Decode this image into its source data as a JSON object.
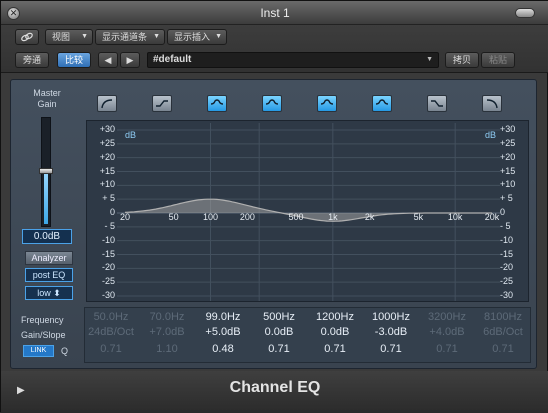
{
  "window": {
    "title": "Inst 1",
    "close_glyph": "✕"
  },
  "toolbar": {
    "link_icon": "link-icon",
    "view_label": "视图",
    "show_channel_strip_label": "显示通道条",
    "show_insert_label": "显示插入",
    "bypass_label": "旁通",
    "compare_label": "比较",
    "prev_label": "◀",
    "next_label": "▶",
    "preset_value": "#default",
    "copy_label": "拷贝",
    "paste_label": "粘贴",
    "dropdown_glyph": "▼"
  },
  "plugin": {
    "name": "Channel EQ",
    "master_gain_label": "Master\nGain",
    "master_gain_value": "0.0dB",
    "master_gain_level": 0.5,
    "analyzer_label": "Analyzer",
    "post_eq_label": "post EQ",
    "resolution_label": "low",
    "resolution_glyph": "⬍",
    "band_buttons": [
      {
        "icon": "low-cut-icon",
        "on": false
      },
      {
        "icon": "low-shelf-icon",
        "on": false
      },
      {
        "icon": "bell-band-icon",
        "on": true
      },
      {
        "icon": "bell-band-icon",
        "on": true
      },
      {
        "icon": "bell-band-icon",
        "on": true
      },
      {
        "icon": "bell-band-icon",
        "on": true
      },
      {
        "icon": "high-shelf-icon",
        "on": false
      },
      {
        "icon": "high-cut-icon",
        "on": false
      }
    ],
    "graph": {
      "db_unit": "dB",
      "db_ticks": [
        "+30",
        "+25",
        "+20",
        "+15",
        "+10",
        "+ 5",
        "0",
        "- 5",
        "-10",
        "-15",
        "-20",
        "-25",
        "-30"
      ],
      "freq_ticks": [
        "20",
        "50",
        "100",
        "200",
        "500",
        "1k",
        "2k",
        "5k",
        "10k",
        "20k"
      ],
      "curve_color": "#b0b0b0",
      "grid_color": "#43505e"
    },
    "params": {
      "frequency_label": "Frequency",
      "gain_slope_label": "Gain/Slope",
      "q_label": "Q",
      "link_label": "LINK",
      "bands": [
        {
          "freq": "50.0Hz",
          "gain": "24dB/Oct",
          "q": "0.71",
          "on": false
        },
        {
          "freq": "70.0Hz",
          "gain": "+7.0dB",
          "q": "1.10",
          "on": false
        },
        {
          "freq": "99.0Hz",
          "gain": "+5.0dB",
          "q": "0.48",
          "on": true
        },
        {
          "freq": "500Hz",
          "gain": "0.0dB",
          "q": "0.71",
          "on": true
        },
        {
          "freq": "1200Hz",
          "gain": "0.0dB",
          "q": "0.71",
          "on": true
        },
        {
          "freq": "1000Hz",
          "gain": "-3.0dB",
          "q": "0.71",
          "on": true
        },
        {
          "freq": "3200Hz",
          "gain": "+4.0dB",
          "q": "0.71",
          "on": false
        },
        {
          "freq": "8100Hz",
          "gain": "6dB/Oct",
          "q": "0.71",
          "on": false
        }
      ]
    },
    "footer_arrow": "▶"
  }
}
